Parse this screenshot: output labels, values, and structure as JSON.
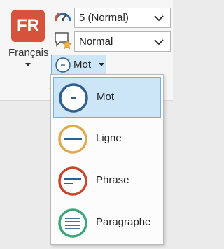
{
  "language_button": {
    "badge": "FR",
    "label": "Français"
  },
  "speed_select": {
    "value": "5 (Normal)",
    "icon": "speedometer-icon"
  },
  "voice_select": {
    "value": "Normal",
    "icon": "speech-bubble-star-icon"
  },
  "granularity_button": {
    "label": "Mot",
    "icon": "circle-word-icon"
  },
  "menu": {
    "items": [
      {
        "label": "Mot",
        "icon": "word-icon",
        "color": "#2f5f8a",
        "selected": true
      },
      {
        "label": "Ligne",
        "icon": "line-icon",
        "color": "#e0a94e",
        "selected": false
      },
      {
        "label": "Phrase",
        "icon": "sentence-icon",
        "color": "#c9442c",
        "selected": false
      },
      {
        "label": "Paragraphe",
        "icon": "paragraph-icon",
        "color": "#3aa577",
        "selected": false
      }
    ]
  },
  "colors": {
    "accent_selected": "#cde6f7",
    "badge": "#d4533a"
  }
}
